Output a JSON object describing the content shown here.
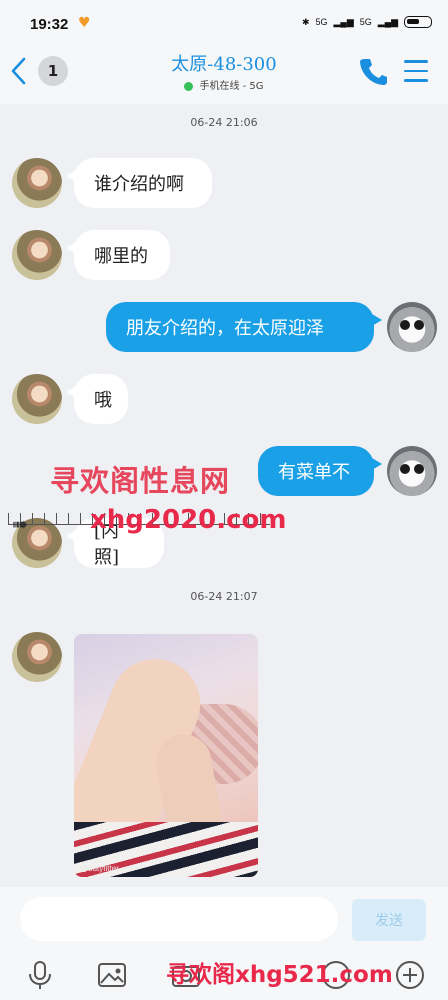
{
  "status_bar": {
    "time": "19:32",
    "network": [
      "5G",
      "5G"
    ]
  },
  "header": {
    "back_icon": "chevron-left-icon",
    "unread_count": "1",
    "title": "太原-48-300",
    "subtitle": "手机在线 - 5G",
    "online_color": "#36c05a",
    "accent_color": "#1a8fe0"
  },
  "messages": [
    {
      "side": "left",
      "text": "谁介绍的啊"
    },
    {
      "side": "left",
      "text": "哪里的"
    },
    {
      "side": "right",
      "text": "朋友介绍的，在太原迎泽"
    },
    {
      "side": "left",
      "text": "哦"
    },
    {
      "side": "right",
      "text": "有菜单不"
    },
    {
      "side": "left",
      "text": "[内照]"
    },
    {
      "side": "left",
      "type": "image",
      "caption": "@outyfitter"
    }
  ],
  "timestamps": [
    "06-24 21:06",
    "06-24 21:07"
  ],
  "watermarks": {
    "line1": "寻欢阁性息网",
    "line2": "xhg2020.com",
    "line3": "寻欢阁xhg521.com"
  },
  "input": {
    "placeholder": "",
    "send_label": "发送"
  },
  "toolbar": [
    "microphone-icon",
    "image-icon",
    "camera-icon",
    "emoji-icon",
    "plus-icon"
  ]
}
